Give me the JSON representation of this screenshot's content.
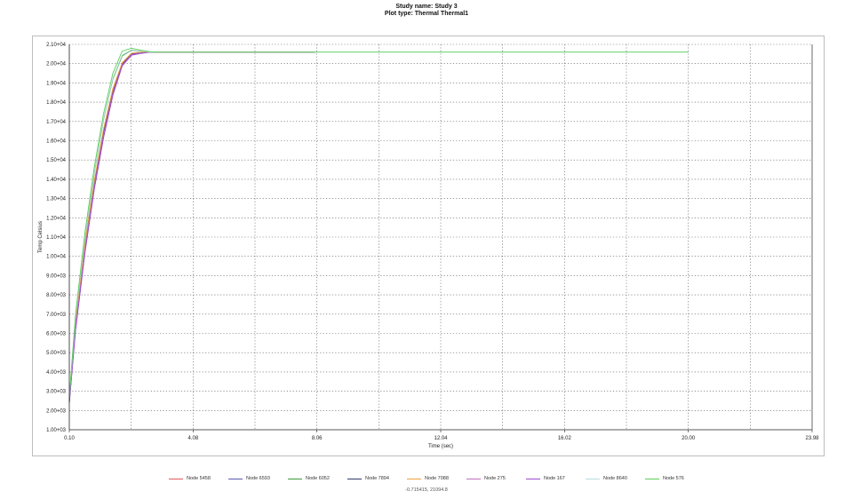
{
  "title": "Study name: Study 3",
  "subtitle": "Plot type: Thermal Thermal1",
  "coordinate_readout": "-0.715415, 21094.8",
  "chart_data": {
    "type": "line",
    "xlabel": "Time (sec)",
    "ylabel": "Temp Celsius",
    "xlim": [
      0.1,
      23.98
    ],
    "ylim": [
      1000,
      21000
    ],
    "x_ticks": [
      {
        "v": 0.1,
        "label": "0.10"
      },
      {
        "v": 4.08,
        "label": "4.08"
      },
      {
        "v": 8.06,
        "label": "8.06"
      },
      {
        "v": 12.04,
        "label": "12.04"
      },
      {
        "v": 16.02,
        "label": "16.02"
      },
      {
        "v": 20.0,
        "label": "20.00"
      },
      {
        "v": 23.98,
        "label": "23.98"
      }
    ],
    "y_ticks": [
      {
        "v": 1000,
        "label": "1.00+03"
      },
      {
        "v": 2000,
        "label": "2.00+03"
      },
      {
        "v": 3000,
        "label": "3.00+03"
      },
      {
        "v": 4000,
        "label": "4.00+03"
      },
      {
        "v": 5000,
        "label": "5.00+03"
      },
      {
        "v": 6000,
        "label": "6.00+03"
      },
      {
        "v": 7000,
        "label": "7.00+03"
      },
      {
        "v": 8000,
        "label": "8.00+03"
      },
      {
        "v": 9000,
        "label": "9.00+03"
      },
      {
        "v": 10000,
        "label": "1.00+04"
      },
      {
        "v": 11000,
        "label": "1.10+04"
      },
      {
        "v": 12000,
        "label": "1.20+04"
      },
      {
        "v": 13000,
        "label": "1.30+04"
      },
      {
        "v": 14000,
        "label": "1.40+04"
      },
      {
        "v": 15000,
        "label": "1.50+04"
      },
      {
        "v": 16000,
        "label": "1.60+04"
      },
      {
        "v": 17000,
        "label": "1.70+04"
      },
      {
        "v": 18000,
        "label": "1.80+04"
      },
      {
        "v": 19000,
        "label": "1.90+04"
      },
      {
        "v": 20000,
        "label": "2.00+04"
      },
      {
        "v": 21000,
        "label": "2.10+04"
      }
    ],
    "grid": true,
    "legend_position": "bottom",
    "series": [
      {
        "name": "Node 5458",
        "color": "#e05a5a",
        "x": [
          0.1,
          0.3,
          0.6,
          0.9,
          1.2,
          1.5,
          1.8,
          2.1,
          2.4,
          2.7,
          3.0,
          8.0
        ],
        "y": [
          2500,
          6500,
          10500,
          13800,
          16500,
          18600,
          20000,
          20500,
          20550,
          20600,
          20600,
          20600
        ]
      },
      {
        "name": "Node 6593",
        "color": "#5a5ab4",
        "x": [
          0.1,
          0.3,
          0.6,
          0.9,
          1.2,
          1.5,
          1.8,
          2.1,
          2.4,
          2.7,
          3.0,
          8.0
        ],
        "y": [
          2400,
          6200,
          10200,
          13500,
          16200,
          18400,
          19900,
          20450,
          20550,
          20600,
          20600,
          20600
        ]
      },
      {
        "name": "Node 6052",
        "color": "#3c9a3c",
        "x": [
          0.1,
          0.3,
          0.6,
          0.9,
          1.2,
          1.5,
          1.8,
          2.1,
          2.4,
          2.7,
          3.0,
          8.0
        ],
        "y": [
          2600,
          6800,
          10900,
          14300,
          17100,
          19200,
          20400,
          20700,
          20650,
          20600,
          20600,
          20600
        ]
      },
      {
        "name": "Node 7894",
        "color": "#2f3a6b",
        "x": [
          0.1,
          0.3,
          0.6,
          0.9,
          1.2,
          1.5,
          1.8,
          2.1,
          2.4,
          2.7,
          3.0,
          8.0
        ],
        "y": [
          2450,
          6400,
          10400,
          13700,
          16400,
          18500,
          19950,
          20500,
          20550,
          20600,
          20600,
          20600
        ]
      },
      {
        "name": "Node 7088",
        "color": "#f0a040",
        "x": [
          0.1,
          0.3,
          0.6,
          0.9,
          1.2,
          1.5,
          1.8,
          2.1,
          2.4,
          2.7,
          3.0,
          8.0
        ],
        "y": [
          2550,
          6600,
          10600,
          13900,
          16600,
          18700,
          20050,
          20550,
          20600,
          20600,
          20600,
          20600
        ]
      },
      {
        "name": "Node 275",
        "color": "#c070c0",
        "x": [
          0.1,
          0.3,
          0.6,
          0.9,
          1.2,
          1.5,
          1.8,
          2.1,
          2.4,
          2.7,
          3.0,
          8.0
        ],
        "y": [
          2420,
          6300,
          10300,
          13600,
          16300,
          18450,
          19920,
          20480,
          20540,
          20600,
          20600,
          20600
        ]
      },
      {
        "name": "Node 167",
        "color": "#9a4ad0",
        "x": [
          0.1,
          0.3,
          0.6,
          0.9,
          1.2,
          1.5,
          1.8,
          2.1,
          2.4,
          2.7,
          3.0,
          8.0
        ],
        "y": [
          2380,
          6150,
          10150,
          13450,
          16150,
          18350,
          19880,
          20440,
          20530,
          20600,
          20600,
          20600
        ]
      },
      {
        "name": "Node 8640",
        "color": "#b8dcdc",
        "x": [
          0.1,
          0.3,
          0.6,
          0.9,
          1.2,
          1.5,
          1.8,
          2.1,
          2.4,
          2.7,
          3.0,
          20.0
        ],
        "y": [
          2620,
          6850,
          10950,
          14350,
          17150,
          19250,
          20450,
          20720,
          20660,
          20600,
          20600,
          20600
        ]
      },
      {
        "name": "Node 576",
        "color": "#5ad05a",
        "x": [
          0.1,
          0.3,
          0.6,
          0.9,
          1.2,
          1.5,
          1.8,
          2.1,
          2.4,
          2.7,
          3.0,
          20.0
        ],
        "y": [
          2700,
          7000,
          11200,
          14600,
          17400,
          19500,
          20650,
          20800,
          20700,
          20620,
          20600,
          20600
        ]
      }
    ]
  }
}
